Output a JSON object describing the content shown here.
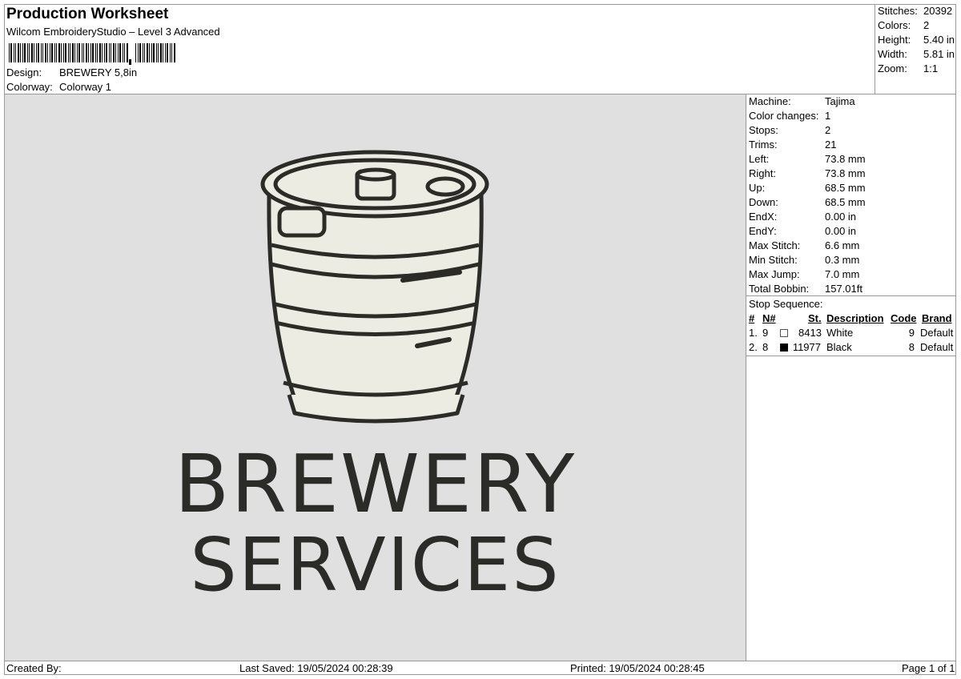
{
  "header": {
    "title": "Production Worksheet",
    "subtitle": "Wilcom EmbroideryStudio – Level 3 Advanced",
    "design_label": "Design:",
    "design_value": "BREWERY 5,8in",
    "colorway_label": "Colorway:",
    "colorway_value": "Colorway 1"
  },
  "summary": [
    {
      "label": "Stitches:",
      "value": "20392"
    },
    {
      "label": "Colors:",
      "value": "2"
    },
    {
      "label": "Height:",
      "value": "5.40 in"
    },
    {
      "label": "Width:",
      "value": "5.81 in"
    },
    {
      "label": "Zoom:",
      "value": "1:1"
    }
  ],
  "machine_info": [
    {
      "label": "Machine:",
      "value": "Tajima"
    },
    {
      "label": "Color changes:",
      "value": "1"
    },
    {
      "label": "Stops:",
      "value": "2"
    },
    {
      "label": "Trims:",
      "value": "21"
    },
    {
      "label": "Left:",
      "value": "73.8 mm"
    },
    {
      "label": "Right:",
      "value": "73.8 mm"
    },
    {
      "label": "Up:",
      "value": "68.5 mm"
    },
    {
      "label": "Down:",
      "value": "68.5 mm"
    },
    {
      "label": "EndX:",
      "value": "0.00 in"
    },
    {
      "label": "EndY:",
      "value": "0.00 in"
    },
    {
      "label": "Max Stitch:",
      "value": "6.6 mm"
    },
    {
      "label": "Min Stitch:",
      "value": "0.3 mm"
    },
    {
      "label": "Max Jump:",
      "value": "7.0 mm"
    },
    {
      "label": "Total Bobbin:",
      "value": "157.01ft"
    }
  ],
  "stop_sequence": {
    "title": "Stop Sequence:",
    "columns": [
      "#",
      "N#",
      "St.",
      "Description",
      "Code",
      "Brand"
    ],
    "rows": [
      {
        "index": "1.",
        "needle": "9",
        "swatch": "#ffffff",
        "stitches": "8413",
        "description": "White",
        "code": "9",
        "brand": "Default"
      },
      {
        "index": "2.",
        "needle": "8",
        "swatch": "#000000",
        "stitches": "11977",
        "description": "Black",
        "code": "8",
        "brand": "Default"
      }
    ]
  },
  "design": {
    "line1": "BREWERY",
    "line2": "SERVICES",
    "colors": {
      "fill": "#ecece3",
      "outline": "#2b2b27",
      "background": "#e0e0e0"
    }
  },
  "footer": {
    "created_by": "Created By:",
    "last_saved": "Last Saved: 19/05/2024 00:28:39",
    "printed": "Printed: 19/05/2024 00:28:45",
    "page": "Page 1 of 1"
  }
}
